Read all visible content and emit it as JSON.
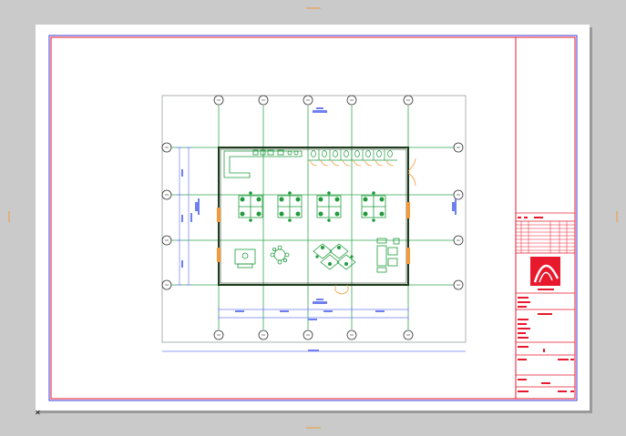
{
  "viewport": {
    "name": "layout-sheet-view"
  },
  "colors": {
    "workspace": "#c9cac9",
    "paper": "#ffffff",
    "border_red": "#e8192c",
    "border_blue": "#3b3bd8",
    "grid_green": "#2fa84f",
    "wall_dark": "#1d3b1d",
    "furniture_green": "#1e9b3c",
    "dim_blue": "#6f7ff0",
    "door_orange": "#f39a3a",
    "titleblock_red": "#e8192c"
  },
  "grid": {
    "column_labels": [
      "①",
      "②",
      "③",
      "④",
      "⑤"
    ],
    "row_labels": [
      "Ⓐ",
      "Ⓑ",
      "Ⓒ",
      "Ⓓ"
    ]
  },
  "titleblock": {
    "logo_icon": "logo-arc-icon"
  }
}
